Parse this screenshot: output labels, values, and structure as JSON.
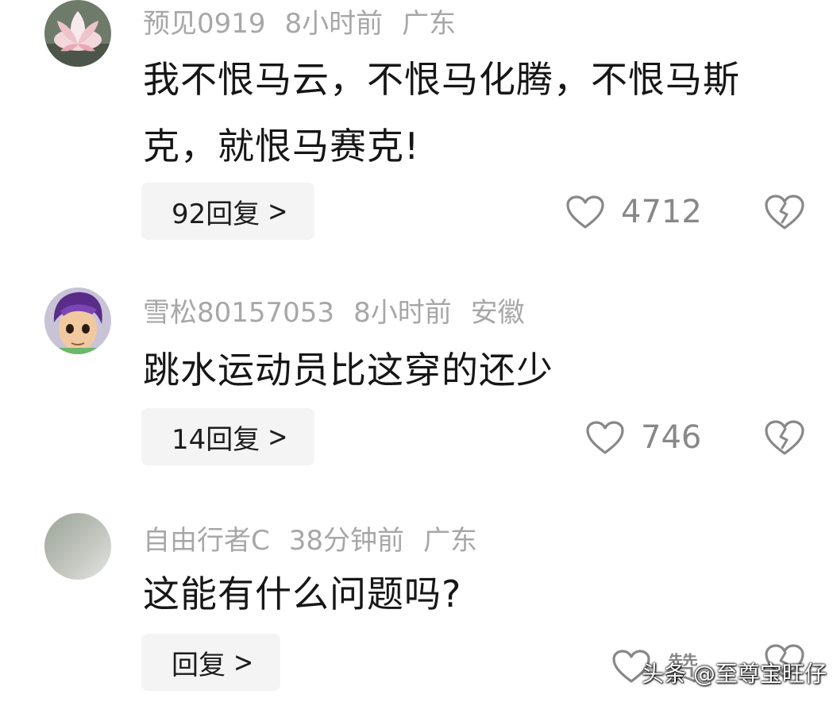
{
  "comments": [
    {
      "username": "预见0919",
      "time": "8小时前",
      "location": "广东",
      "text": "我不恨马云，不恨马化腾，不恨马斯克，就恨马赛克!",
      "reply_label": "92回复",
      "likes": "4712",
      "avatar_icon": "lotus-flower-avatar"
    },
    {
      "username": "雪松80157053",
      "time": "8小时前",
      "location": "安徽",
      "text": "跳水运动员比这穿的还少",
      "reply_label": "14回复",
      "likes": "746",
      "avatar_icon": "cartoon-boy-avatar"
    },
    {
      "username": "自由行者C",
      "time": "38分钟前",
      "location": "广东",
      "text": "这能有什么问题吗?",
      "reply_label": "回复",
      "likes": "赞",
      "avatar_icon": "gray-gradient-avatar"
    }
  ],
  "watermark": "头条 @至尊宝旺仔",
  "colors": {
    "meta_text": "#a7a7a7",
    "reply_bg": "#f4f4f4",
    "icon_gray": "#888888"
  },
  "icons": [
    "heart-icon",
    "broken-heart-icon",
    "chevron-right-icon"
  ]
}
